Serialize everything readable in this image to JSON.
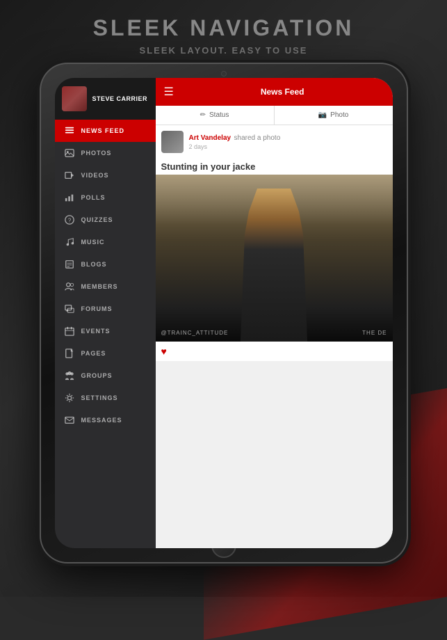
{
  "page": {
    "title": "SLEEK NAVIGATION",
    "subtitle": "SLEEK LAYOUT. EASY TO USE"
  },
  "sidebar": {
    "username": "STEVE CARRIER",
    "nav_items": [
      {
        "id": "news-feed",
        "label": "NEWS FEED",
        "icon": "news",
        "active": true
      },
      {
        "id": "photos",
        "label": "PHOTOS",
        "icon": "photos",
        "active": false
      },
      {
        "id": "videos",
        "label": "VIDEOS",
        "icon": "videos",
        "active": false
      },
      {
        "id": "polls",
        "label": "POLLS",
        "icon": "polls",
        "active": false
      },
      {
        "id": "quizzes",
        "label": "QUIZZES",
        "icon": "quizzes",
        "active": false
      },
      {
        "id": "music",
        "label": "MUSIC",
        "icon": "music",
        "active": false
      },
      {
        "id": "blogs",
        "label": "BLOGS",
        "icon": "blogs",
        "active": false
      },
      {
        "id": "members",
        "label": "MEMBERS",
        "icon": "members",
        "active": false
      },
      {
        "id": "forums",
        "label": "FORUMS",
        "icon": "forums",
        "active": false
      },
      {
        "id": "events",
        "label": "EVENTS",
        "icon": "events",
        "active": false
      },
      {
        "id": "pages",
        "label": "PAGES",
        "icon": "pages",
        "active": false
      },
      {
        "id": "groups",
        "label": "GROUPS",
        "icon": "groups",
        "active": false
      },
      {
        "id": "settings",
        "label": "SETTINGS",
        "icon": "settings",
        "active": false
      },
      {
        "id": "messages",
        "label": "MESSAGES",
        "icon": "messages",
        "active": false
      }
    ]
  },
  "topbar": {
    "title": "News Feed",
    "menu_icon": "≡"
  },
  "tabs": [
    {
      "id": "status",
      "label": "Status",
      "icon": "✏"
    },
    {
      "id": "photo",
      "label": "Photo",
      "icon": "📷"
    }
  ],
  "post": {
    "author": "Art Vandelay",
    "action": "shared a photo",
    "time": "2 days",
    "text": "Stunting in your jacke",
    "image_left": "@TRAINC_ATTITUDE",
    "image_right": "THE DE"
  }
}
